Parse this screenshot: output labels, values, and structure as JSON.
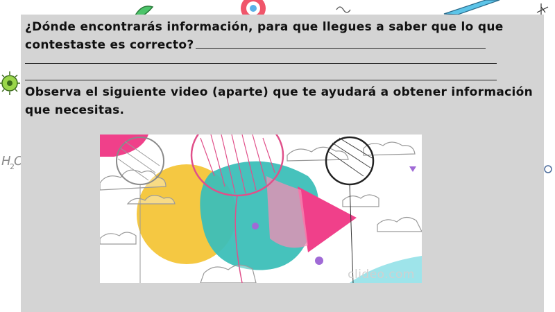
{
  "worksheet": {
    "question_line1": "¿Dónde encontrarás información, para que llegues a saber que lo que",
    "question_line2": "contestaste  es correcto?",
    "instruction": "Observa el siguiente video (aparte) que te ayudará a obtener información que necesitas."
  },
  "video": {
    "watermark": "clideo.com",
    "shape_colors": [
      "#f5c842",
      "#3cbfb8",
      "#f0408a",
      "#f48cb4",
      "#a06ad6",
      "#7ad8e0"
    ]
  },
  "background": {
    "doodles": [
      "leaf-icon",
      "candy-icon",
      "virus-icon",
      "chemistry-formula",
      "pencil-icon",
      "star-icon"
    ]
  }
}
